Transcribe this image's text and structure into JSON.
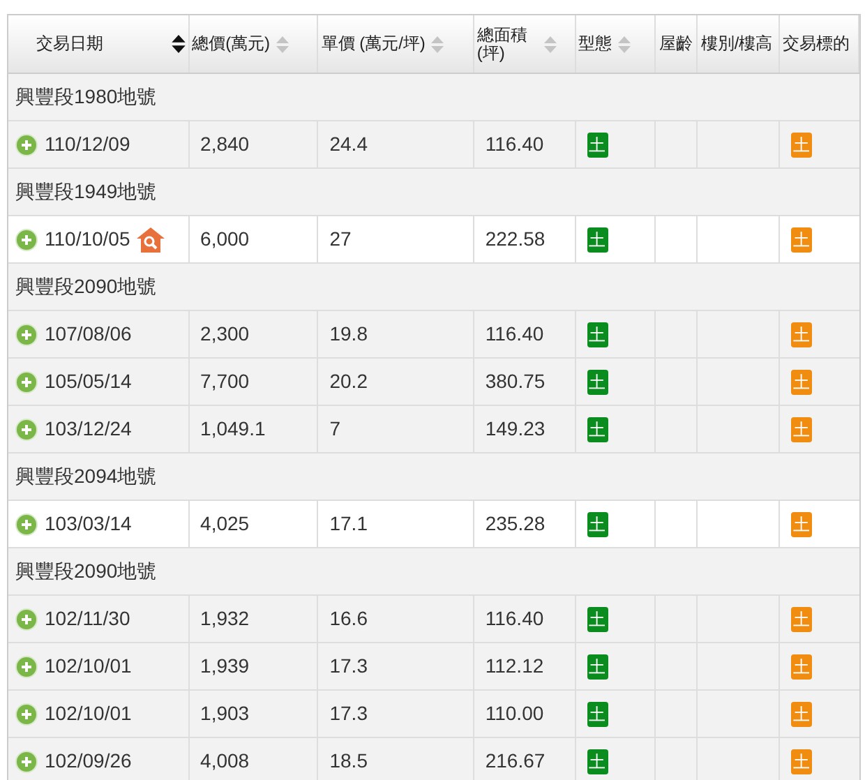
{
  "table": {
    "columns": [
      {
        "label": "交易日期",
        "sortable": true,
        "sorted": true
      },
      {
        "label": "總價(萬元)",
        "sortable": true,
        "sorted": false
      },
      {
        "label": "單價 (萬元/坪)",
        "sortable": true,
        "sorted": false
      },
      {
        "label": "總面積 (坪)",
        "sortable": true,
        "sorted": false
      },
      {
        "label": "型態",
        "sortable": true,
        "sorted": false
      },
      {
        "label": "屋齡",
        "sortable": false
      },
      {
        "label": "樓別/樓高",
        "sortable": false
      },
      {
        "label": "交易標的",
        "sortable": false
      }
    ],
    "groups": [
      {
        "title": "興豐段1980地號",
        "shaded": true,
        "rows": [
          {
            "date": "110/12/09",
            "house_badge": false,
            "total": "2,840",
            "unit": "24.4",
            "area": "116.40",
            "type": "土",
            "target": "土"
          }
        ]
      },
      {
        "title": "興豐段1949地號",
        "shaded": false,
        "rows": [
          {
            "date": "110/10/05",
            "house_badge": true,
            "total": "6,000",
            "unit": "27",
            "area": "222.58",
            "type": "土",
            "target": "土"
          }
        ]
      },
      {
        "title": "興豐段2090地號",
        "shaded": true,
        "rows": [
          {
            "date": "107/08/06",
            "house_badge": false,
            "total": "2,300",
            "unit": "19.8",
            "area": "116.40",
            "type": "土",
            "target": "土"
          },
          {
            "date": "105/05/14",
            "house_badge": false,
            "total": "7,700",
            "unit": "20.2",
            "area": "380.75",
            "type": "土",
            "target": "土"
          },
          {
            "date": "103/12/24",
            "house_badge": false,
            "total": "1,049.1",
            "unit": "7",
            "area": "149.23",
            "type": "土",
            "target": "土"
          }
        ]
      },
      {
        "title": "興豐段2094地號",
        "shaded": false,
        "rows": [
          {
            "date": "103/03/14",
            "house_badge": false,
            "total": "4,025",
            "unit": "17.1",
            "area": "235.28",
            "type": "土",
            "target": "土"
          }
        ]
      },
      {
        "title": "興豐段2090地號",
        "shaded": true,
        "rows": [
          {
            "date": "102/11/30",
            "house_badge": false,
            "total": "1,932",
            "unit": "16.6",
            "area": "116.40",
            "type": "土",
            "target": "土"
          },
          {
            "date": "102/10/01",
            "house_badge": false,
            "total": "1,939",
            "unit": "17.3",
            "area": "112.12",
            "type": "土",
            "target": "土"
          },
          {
            "date": "102/10/01",
            "house_badge": false,
            "total": "1,903",
            "unit": "17.3",
            "area": "110.00",
            "type": "土",
            "target": "土"
          },
          {
            "date": "102/09/26",
            "house_badge": false,
            "total": "4,008",
            "unit": "18.5",
            "area": "216.67",
            "type": "土",
            "target": "土"
          }
        ]
      }
    ]
  }
}
